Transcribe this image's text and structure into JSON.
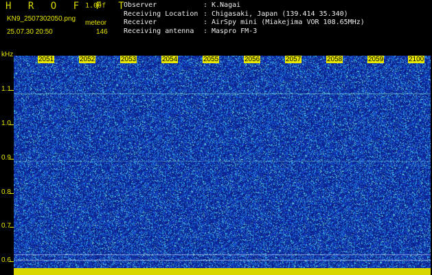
{
  "header": {
    "brand": "H R O F F T",
    "version": "1.00f",
    "filename": "KN9_2507302050.png",
    "meteor_label": "meteor",
    "datetime": "25.07.30 20:50",
    "meteor_count": "146"
  },
  "info": [
    {
      "key": "Observer",
      "value": "K.Nagai"
    },
    {
      "key": "Receiving Location",
      "value": "Chigasaki, Japan (139.414 35.340)"
    },
    {
      "key": "Receiver",
      "value": "AirSpy mini (Miakejima VOR 108.65MHz)"
    },
    {
      "key": "Receiving antenna",
      "value": "Maspro FM-3"
    }
  ],
  "spectrogram": {
    "y_unit": "kHz",
    "y_ticks": [
      "1.1",
      "1.0",
      "0.9",
      "0.8",
      "0.7",
      "0.6"
    ],
    "x_ticks": [
      "2051",
      "2052",
      "2053",
      "2054",
      "2055",
      "2056",
      "2057",
      "2058",
      "2059",
      "2100"
    ],
    "colors": {
      "background": "#102a9a",
      "noise_low": "#1a3ac8",
      "noise_mid": "#2aa0e0",
      "noise_high": "#80f0d8",
      "label": "#e8e800"
    }
  }
}
